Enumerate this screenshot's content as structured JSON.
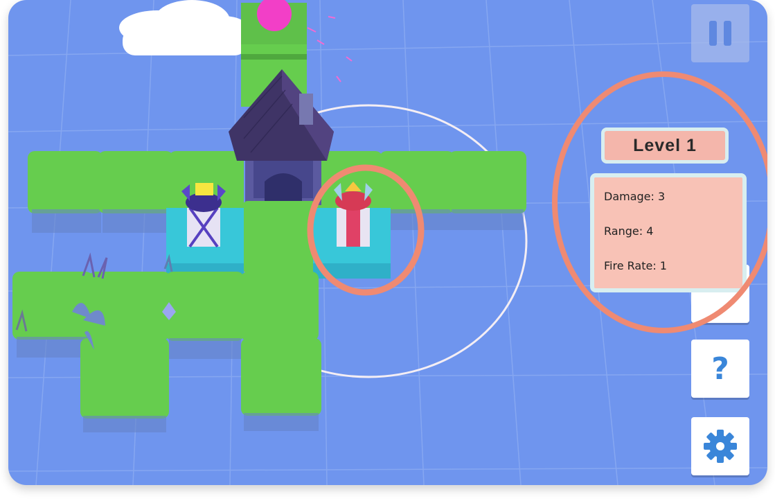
{
  "hud": {
    "level_label": "Level 1",
    "stats": [
      {
        "label": "Damage: 3"
      },
      {
        "label": "Range: 4"
      },
      {
        "label": "Fire Rate: 1"
      }
    ],
    "help_label": "?"
  },
  "icons": {
    "pause": "pause-icon",
    "help": "question-mark-icon",
    "settings": "gear-icon"
  },
  "colors": {
    "background": "#6f95ee",
    "grass": "#66cd4e",
    "water": "#38c7d9",
    "highlight": "#ef8a72",
    "panel": "#f8c2b6",
    "accent_blue": "#3a86d9",
    "enemy_orb": "#f23fc7"
  }
}
